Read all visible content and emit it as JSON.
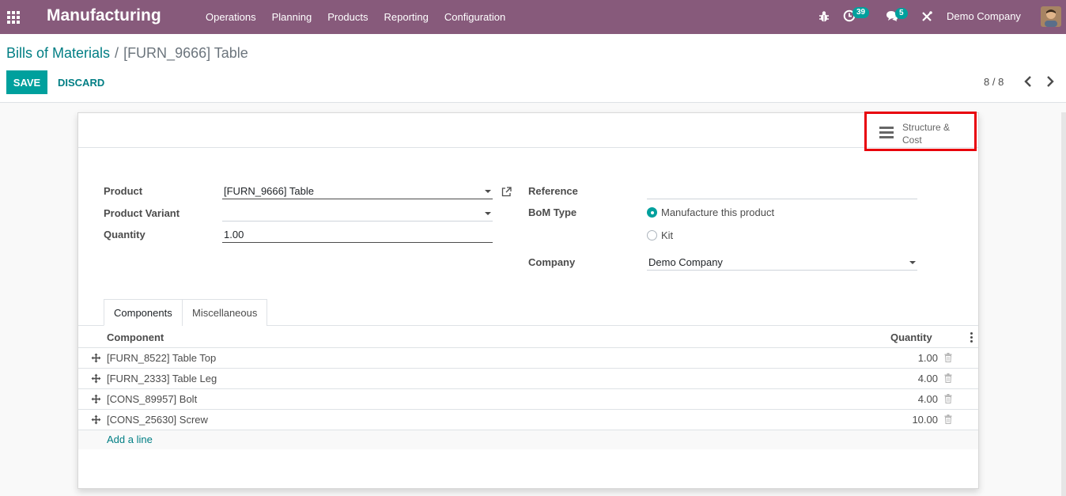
{
  "navbar": {
    "brand": "Manufacturing",
    "menu": [
      "Operations",
      "Planning",
      "Products",
      "Reporting",
      "Configuration"
    ],
    "activity_count": "39",
    "message_count": "5",
    "company": "Demo Company",
    "bg_color": "#875a7b"
  },
  "breadcrumb": {
    "parent": "Bills of Materials",
    "separator": "/",
    "current": "[FURN_9666] Table"
  },
  "actions": {
    "save_label": "SAVE",
    "discard_label": "DISCARD"
  },
  "pager": {
    "value": "8 / 8"
  },
  "smart_button": {
    "label": "Structure & Cost",
    "icon": "bars-icon"
  },
  "form": {
    "product_label": "Product",
    "product_value": "[FURN_9666] Table",
    "variant_label": "Product Variant",
    "variant_value": "",
    "quantity_label": "Quantity",
    "quantity_value": "1.00",
    "reference_label": "Reference",
    "reference_value": "",
    "bom_type_label": "BoM Type",
    "bom_type_options": [
      "Manufacture this product",
      "Kit"
    ],
    "bom_type_selected": "Manufacture this product",
    "company_label": "Company",
    "company_value": "Demo Company"
  },
  "tabs": [
    "Components",
    "Miscellaneous"
  ],
  "table": {
    "columns": [
      "Component",
      "Quantity"
    ],
    "rows": [
      {
        "component": "[FURN_8522] Table Top",
        "quantity": "1.00"
      },
      {
        "component": "[FURN_2333] Table Leg",
        "quantity": "4.00"
      },
      {
        "component": "[CONS_89957] Bolt",
        "quantity": "4.00"
      },
      {
        "component": "[CONS_25630] Screw",
        "quantity": "10.00"
      }
    ],
    "add_line": "Add a line"
  },
  "colors": {
    "primary": "#00a09d",
    "link": "#017e84",
    "highlight": "#e8000b"
  }
}
